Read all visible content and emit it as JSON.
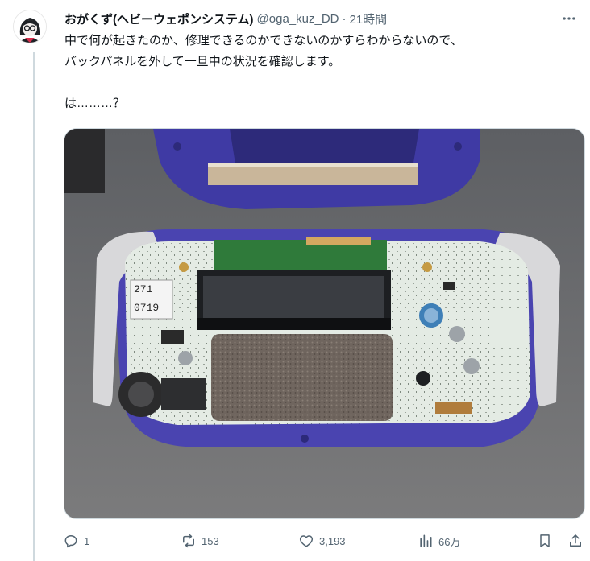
{
  "author": {
    "display_name": "おがくず(ヘビーウェポンシステム)",
    "handle": "@oga_kuz_DD",
    "separator": "·",
    "time": "21時間"
  },
  "tweet": {
    "text": "中で何が起きたのか、修理できるのかできないのかすらわからないので、\nバックパネルを外して一旦中の状況を確認します。\n\nは………？"
  },
  "media": {
    "sticker_top": "271",
    "sticker_bottom": "0719"
  },
  "actions": {
    "replies": "1",
    "retweets": "153",
    "likes": "3,193",
    "views": "66万"
  },
  "icons": {
    "more": "more-icon",
    "reply": "reply-icon",
    "retweet": "retweet-icon",
    "like": "heart-icon",
    "views": "views-icon",
    "bookmark": "bookmark-icon",
    "share": "share-icon"
  },
  "colors": {
    "text": "#0f1419",
    "secondary": "#536471",
    "divider": "#cfd9de",
    "console_purple": "#4a44b0",
    "pcb_green": "#2f7a3a"
  }
}
